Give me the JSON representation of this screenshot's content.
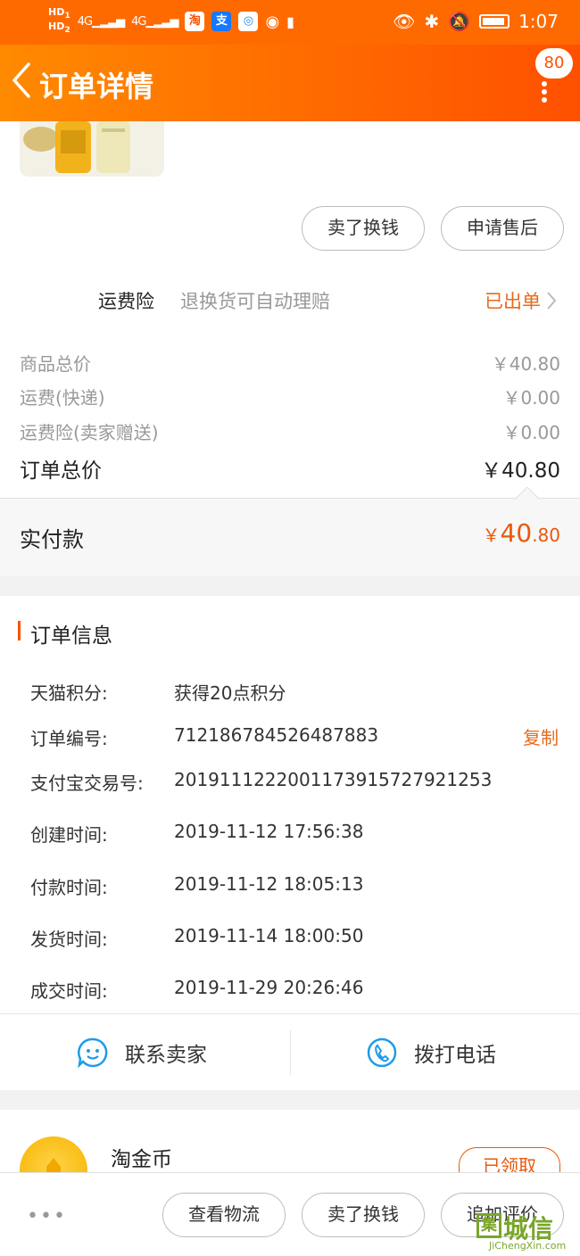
{
  "status_bar": {
    "hd_top": "HD",
    "hd_top_sub": "1",
    "hd_bottom": "HD",
    "hd_bottom_sub": "2",
    "net1": "4G",
    "net2": "4G",
    "app1": "淘",
    "app2": "支",
    "time": "1:07"
  },
  "nav": {
    "title": "订单详情",
    "badge": "80"
  },
  "actions_top": {
    "sell_label": "卖了换钱",
    "after_sales_label": "申请售后"
  },
  "freight_insurance": {
    "label": "运费险",
    "desc": "退换货可自动理赔",
    "status": "已出单"
  },
  "price_summary": {
    "rows": [
      {
        "label": "商品总价",
        "value": "￥40.80"
      },
      {
        "label": "运费(快递)",
        "value": "￥0.00"
      },
      {
        "label": "运费险(卖家赠送)",
        "value": "￥0.00"
      }
    ],
    "total_label": "订单总价",
    "total_value": "￥40.80",
    "paid_label": "实付款",
    "paid_currency": "￥",
    "paid_int": "40",
    "paid_dec": ".80"
  },
  "order_info": {
    "heading": "订单信息",
    "rows": [
      {
        "label": "天猫积分:",
        "value": "获得20点积分"
      },
      {
        "label": "订单编号:",
        "value": "712186784526487883"
      },
      {
        "label": "支付宝交易号:",
        "value": "2019111222001173915727921253"
      },
      {
        "label": "创建时间:",
        "value": "2019-11-12 17:56:38"
      },
      {
        "label": "付款时间:",
        "value": "2019-11-12 18:05:13"
      },
      {
        "label": "发货时间:",
        "value": "2019-11-14 18:00:50"
      },
      {
        "label": "成交时间:",
        "value": "2019-11-29 20:26:46"
      }
    ],
    "copy_label": "复制"
  },
  "contact": {
    "seller_label": "联系卖家",
    "phone_label": "拨打电话"
  },
  "coin": {
    "title": "淘金币",
    "button_label": "已领取"
  },
  "bottom_bar": {
    "more": "•••",
    "logistics_label": "查看物流",
    "sell_label": "卖了换钱",
    "review_label": "追加评价"
  },
  "watermark": {
    "box": "集",
    "main": "城信",
    "sub": "JiChengXin.com"
  },
  "colors": {
    "brand_orange": "#ff5000",
    "accent_orange": "#e86a1a",
    "price_red": "#e8590c"
  }
}
